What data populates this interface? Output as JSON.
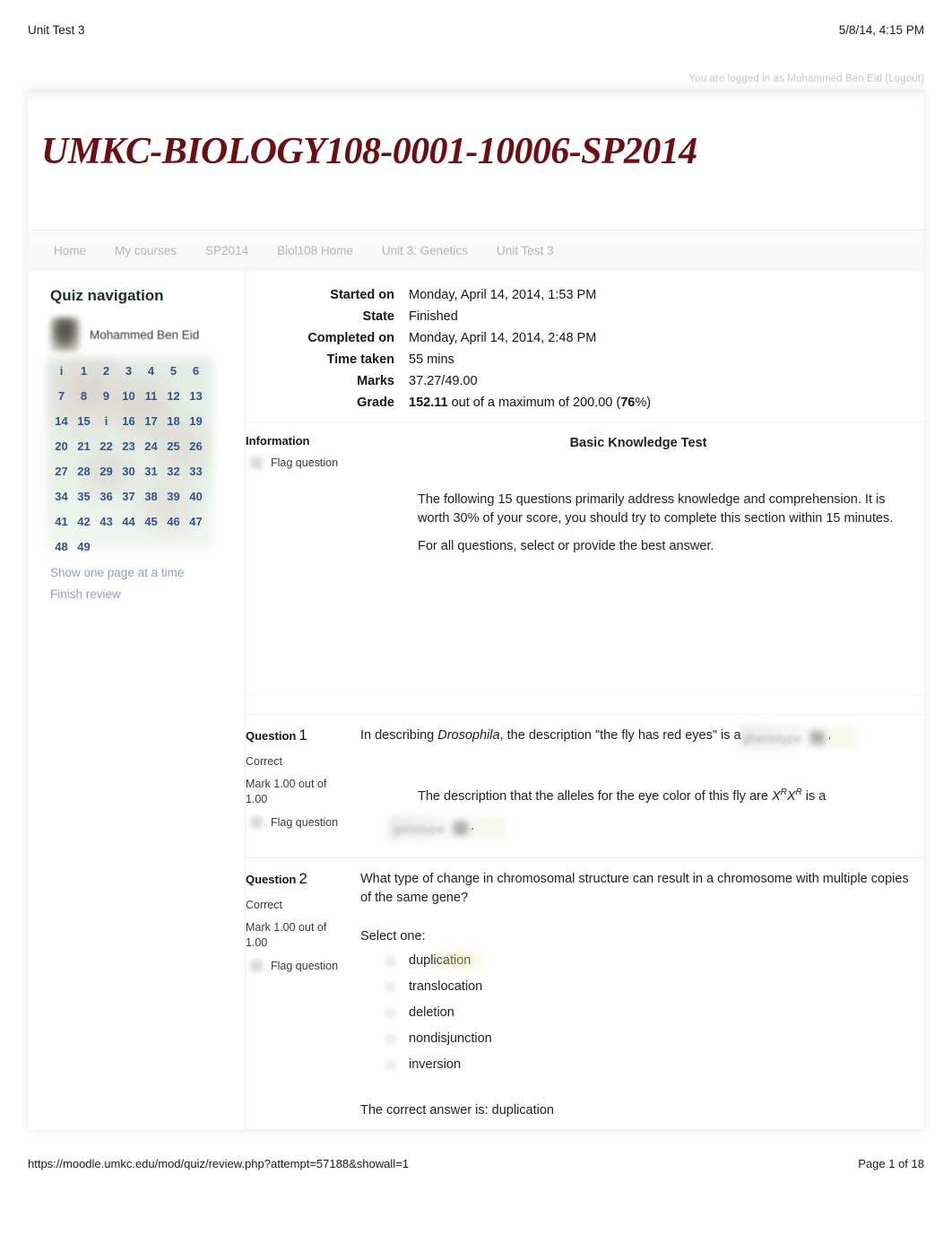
{
  "print_header": {
    "left": "Unit Test 3",
    "right": "5/8/14, 4:15 PM"
  },
  "login_bar": {
    "text": "You are logged in as Mohammed Ben Eid (Logout)"
  },
  "site_title": "UMKC-BIOLOGY108-0001-10006-SP2014",
  "navbar": {
    "items": [
      {
        "label": "Home"
      },
      {
        "label": "My courses"
      },
      {
        "label": "SP2014"
      },
      {
        "label": "Biol108 Home"
      },
      {
        "label": "Unit 3: Genetics"
      },
      {
        "label": "Unit Test 3"
      }
    ]
  },
  "quiz_navigation": {
    "title": "Quiz navigation",
    "user_name": "Mohammed Ben Eid",
    "cells": [
      [
        "i",
        "1",
        "2",
        "3",
        "4",
        "5",
        "6"
      ],
      [
        "7",
        "8",
        "9",
        "10",
        "11",
        "12",
        "13"
      ],
      [
        "14",
        "15",
        "i",
        "16",
        "17",
        "18",
        "19"
      ],
      [
        "20",
        "21",
        "22",
        "23",
        "24",
        "25",
        "26"
      ],
      [
        "27",
        "28",
        "29",
        "30",
        "31",
        "32",
        "33"
      ],
      [
        "34",
        "35",
        "36",
        "37",
        "38",
        "39",
        "40"
      ],
      [
        "41",
        "42",
        "43",
        "44",
        "45",
        "46",
        "47"
      ],
      [
        "48",
        "49"
      ]
    ],
    "show_one_page_link": "Show one page at a time",
    "finish_review_link": "Finish review"
  },
  "summary": {
    "rows": [
      {
        "key": "Started on",
        "value": "Monday, April 14, 2014, 1:53 PM"
      },
      {
        "key": "State",
        "value": "Finished"
      },
      {
        "key": "Completed on",
        "value": "Monday, April 14, 2014, 2:48 PM"
      },
      {
        "key": "Time taken",
        "value": "55 mins"
      },
      {
        "key": "Marks",
        "value": "37.27/49.00"
      }
    ],
    "grade_key": "Grade",
    "grade_value": "152.11",
    "grade_middle": " out of a maximum of 200.00 (",
    "grade_percent": "76",
    "grade_tail": "%)"
  },
  "information": {
    "label": "Information",
    "flag_label": "Flag question",
    "heading": "Basic Knowledge Test",
    "paragraph1": "The following 15 questions primarily address knowledge and comprehension. It is worth 30% of your score, you should try to complete this section within 15 minutes.",
    "paragraph2": "For all questions, select or provide the best answer."
  },
  "question1": {
    "label": "Question",
    "number": "1",
    "state": "Correct",
    "mark": "Mark 1.00 out of 1.00",
    "flag_label": "Flag question",
    "text_a": "In describing ",
    "text_a_italic": "Drosophila",
    "text_a_cont": ", the description \"the fly has red eyes\" is a",
    "answer_a": "phenotype",
    "text_b_start": "The description that the alleles for the eye color of this fly are ",
    "text_b_alleles": "XRXR",
    "text_b_end": " is a",
    "answer_b": "genotype",
    "period": "."
  },
  "question2": {
    "label": "Question",
    "number": "2",
    "state": "Correct",
    "mark": "Mark 1.00 out of 1.00",
    "flag_label": "Flag question",
    "text": "What type of change in chromosomal structure can result in a chromosome with multiple copies of the same gene?",
    "select_one": "Select one:",
    "options": [
      {
        "label": "duplication",
        "chosen": true
      },
      {
        "label": "translocation",
        "chosen": false
      },
      {
        "label": "deletion",
        "chosen": false
      },
      {
        "label": "nondisjunction",
        "chosen": false
      },
      {
        "label": "inversion",
        "chosen": false
      }
    ],
    "correct_answer": "The correct answer is: duplication"
  },
  "print_footer": {
    "left": "https://moodle.umkc.edu/mod/quiz/review.php?attempt=57188&showall=1",
    "right": "Page 1 of 18"
  },
  "colors": {
    "title": "#6b0f15",
    "nav_number": "#2d5694",
    "link": "#8ea3bb",
    "heading": "#18302c"
  }
}
